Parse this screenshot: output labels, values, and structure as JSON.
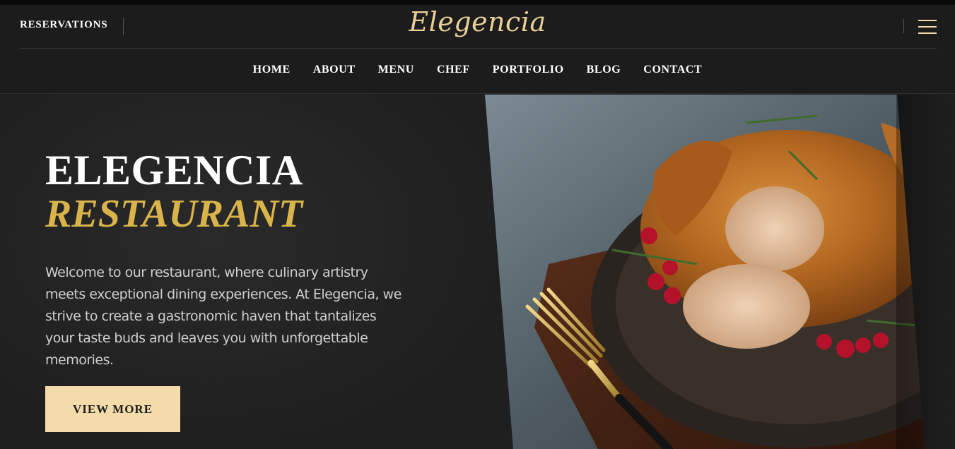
{
  "header": {
    "reservations_label": "RESERVATIONS",
    "logo_text": "Elegencia",
    "menu_icon": "hamburger-icon"
  },
  "nav": {
    "items": [
      {
        "label": "HOME"
      },
      {
        "label": "ABOUT"
      },
      {
        "label": "MENU"
      },
      {
        "label": "CHEF"
      },
      {
        "label": "PORTFOLIO"
      },
      {
        "label": "BLOG"
      },
      {
        "label": "CONTACT"
      }
    ]
  },
  "hero": {
    "title": "ELEGENCIA",
    "subtitle": "RESTAURANT",
    "description": "Welcome to our restaurant, where culinary artistry meets exceptional dining experiences. At Elegencia, we strive to create a gastronomic haven that tantalizes your taste buds and leaves you with unforgettable memories.",
    "button_label": "VIEW MORE"
  },
  "colors": {
    "accent_gold": "#d9b44a",
    "button_bg": "#f4dcaa",
    "logo": "#e9cf98",
    "background": "#1f1f1f"
  }
}
